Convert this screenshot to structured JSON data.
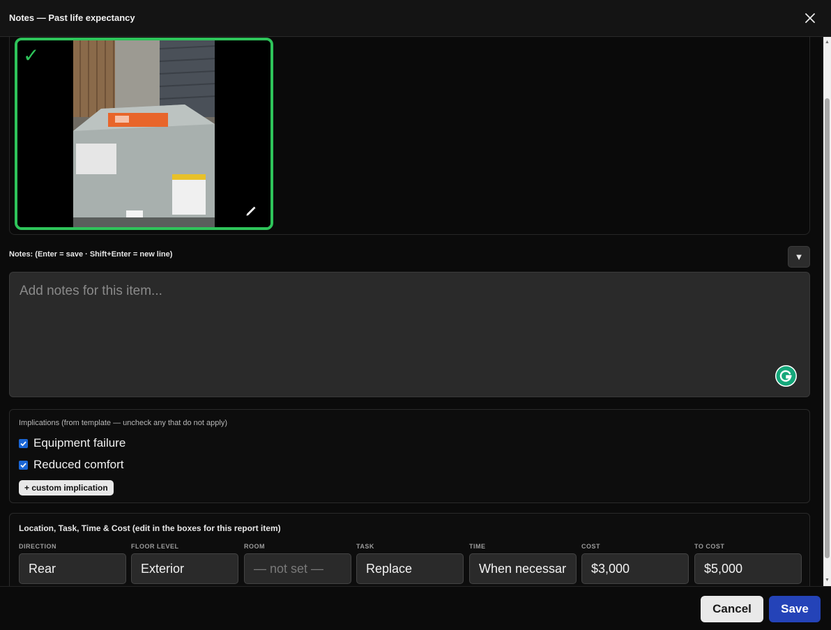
{
  "dialog": {
    "title": "Notes — Past life expectancy"
  },
  "photo": {
    "selected": true,
    "check_glyph": "✓",
    "icons": {
      "check": "check-icon",
      "edit": "pencil-icon"
    }
  },
  "notes": {
    "label": "Notes: (Enter = save · Shift+Enter = new line)",
    "placeholder": "Add notes for this item...",
    "value": "",
    "toggle_glyph": "▼"
  },
  "implications": {
    "heading": "Implications (from template — uncheck any that do not apply)",
    "items": [
      {
        "label": "Equipment failure",
        "checked": true
      },
      {
        "label": "Reduced comfort",
        "checked": true
      }
    ],
    "custom_button": "+ custom implication"
  },
  "location": {
    "heading": "Location, Task, Time & Cost (edit in the boxes for this report item)",
    "fields": [
      {
        "label": "DIRECTION",
        "value": "Rear"
      },
      {
        "label": "FLOOR LEVEL",
        "value": "Exterior"
      },
      {
        "label": "ROOM",
        "value": "— not set —"
      },
      {
        "label": "TASK",
        "value": "Replace"
      },
      {
        "label": "TIME",
        "value": "When necessar"
      },
      {
        "label": "COST",
        "value": "$3,000"
      },
      {
        "label": "TO COST",
        "value": "$5,000"
      }
    ]
  },
  "footer": {
    "cancel_label": "Cancel",
    "save_label": "Save"
  },
  "colors": {
    "accent_green": "#2ec45a",
    "save_blue": "#2443b8",
    "checkbox_blue": "#1a66d6"
  }
}
